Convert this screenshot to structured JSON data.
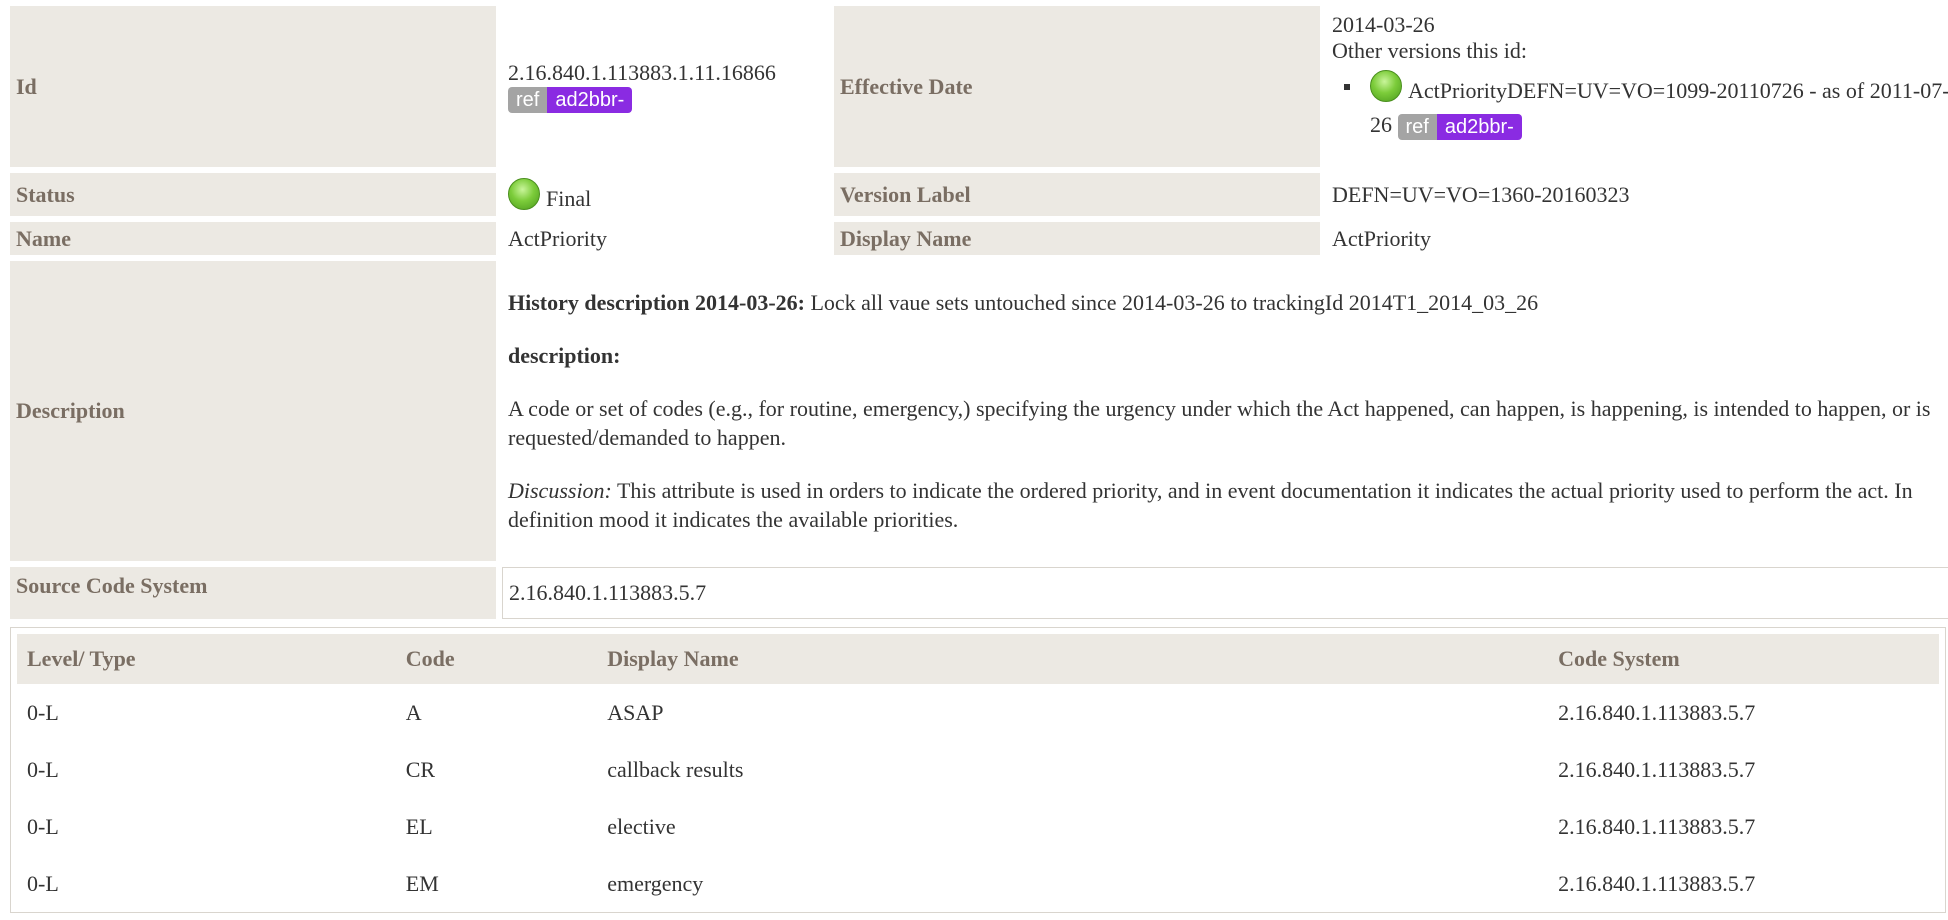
{
  "meta": {
    "id_label": "Id",
    "id_value": "2.16.840.1.113883.1.11.16866",
    "id_badge": {
      "ref": "ref",
      "name": "ad2bbr-"
    },
    "effective_date_label": "Effective Date",
    "effective_date_value": "2014-03-26",
    "other_versions_label": "Other versions this id:",
    "other_versions": [
      {
        "text": "ActPriorityDEFN=UV=VO=1099-20110726 - as of 2011-07-26",
        "badge": {
          "ref": "ref",
          "name": "ad2bbr-"
        }
      }
    ],
    "status_label": "Status",
    "status_value": "Final",
    "version_label_label": "Version Label",
    "version_label_value": "DEFN=UV=VO=1360-20160323",
    "name_label": "Name",
    "name_value": "ActPriority",
    "display_name_label": "Display Name",
    "display_name_value": "ActPriority",
    "description_label": "Description",
    "description": {
      "history_heading": "History description 2014-03-26:",
      "history_text": " Lock all vaue sets untouched since 2014-03-26 to trackingId 2014T1_2014_03_26",
      "desc_heading": "description:",
      "desc_text": "A code or set of codes (e.g., for routine, emergency,) specifying the urgency under which the Act happened, can happen, is happening, is intended to happen, or is requested/demanded to happen.",
      "discussion_label": "Discussion:",
      "discussion_text": " This attribute is used in orders to indicate the ordered priority, and in event documentation it indicates the actual priority used to perform the act. In definition mood it indicates the available priorities."
    },
    "source_code_system_label": "Source Code System",
    "source_code_system_value": "2.16.840.1.113883.5.7"
  },
  "concepts": {
    "headers": [
      "Level/ Type",
      "Code",
      "Display Name",
      "Code System"
    ],
    "rows": [
      [
        "0-L",
        "A",
        "ASAP",
        "2.16.840.1.113883.5.7"
      ],
      [
        "0-L",
        "CR",
        "callback results",
        "2.16.840.1.113883.5.7"
      ],
      [
        "0-L",
        "EL",
        "elective",
        "2.16.840.1.113883.5.7"
      ],
      [
        "0-L",
        "EM",
        "emergency",
        "2.16.840.1.113883.5.7"
      ]
    ]
  },
  "colors": {
    "label_bg": "#ece9e3",
    "label_text": "#7a6e63",
    "badge_ref": "#a4a4a4",
    "badge_name": "#8a2be2",
    "status_green": "#7ccc3a"
  },
  "icons": {
    "status": "status-final-icon"
  }
}
